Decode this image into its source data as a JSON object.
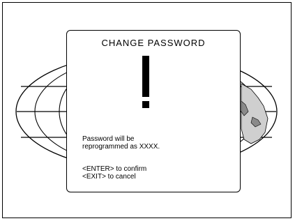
{
  "dialog": {
    "title": "CHANGE PASSWORD",
    "icon": "exclamation-icon",
    "message_line1": "Password will be",
    "message_line2": "reprogrammed as XXXX.",
    "confirm_hint": "<ENTER> to confirm",
    "cancel_hint": "<EXIT> to cancel"
  },
  "background": {
    "icon": "world-globe-icon"
  }
}
